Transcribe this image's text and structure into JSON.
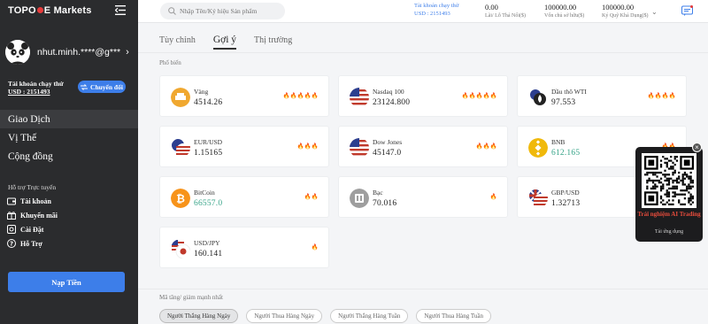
{
  "sidebar": {
    "logo_left": "TOPO",
    "logo_right": "E Markets",
    "username": "nhut.minh.****@g***",
    "account_label": "Tài khoản chạy thử",
    "account_id": "USD : 2151493",
    "switch_label": "Chuyển đổi",
    "nav": [
      {
        "label": "Giao Dịch"
      },
      {
        "label": "Vị Thế"
      },
      {
        "label": "Cộng đồng"
      }
    ],
    "support_label": "Hỗ trợ Trực tuyến",
    "sub_nav": [
      {
        "label": "Tài khoản",
        "icon": "wallet-icon"
      },
      {
        "label": "Khuyến mãi",
        "icon": "gift-icon"
      },
      {
        "label": "Cài Đặt",
        "icon": "settings-icon"
      },
      {
        "label": "Hỗ Trợ",
        "icon": "help-icon"
      }
    ],
    "deposit_label": "Nạp Tiền"
  },
  "header": {
    "search_placeholder": "Nhập Tên/Ký hiệu Sản phẩm",
    "acct_title": "Tài khoản chạy thử",
    "acct_id": "USD : 2151493",
    "stats": [
      {
        "value": "0.00",
        "label": "Lãi/ Lỗ Thả Nổi($)"
      },
      {
        "value": "100000.00",
        "label": "Vốn chủ sở hữu($)"
      },
      {
        "value": "100000.00",
        "label": "Ký Quỹ Khả Dụng($)"
      }
    ]
  },
  "tabs": [
    {
      "label": "Tùy chỉnh"
    },
    {
      "label": "Gợi ý"
    },
    {
      "label": "Thị trường"
    }
  ],
  "section_label": "Phổ biến",
  "cards": [
    {
      "name": "Vàng",
      "price": "4514.26",
      "fire": "🔥🔥🔥🔥🔥",
      "icon": "gold-bar-icon",
      "green": false
    },
    {
      "name": "Nasdaq 100",
      "price": "23124.800",
      "fire": "🔥🔥🔥🔥🔥",
      "icon": "us-flag-icon",
      "green": false
    },
    {
      "name": "Dầu thô WTI",
      "price": "97.553",
      "fire": "🔥🔥🔥🔥",
      "icon": "oil-drop-icon",
      "green": false
    },
    {
      "name": "EUR/USD",
      "price": "1.15165",
      "fire": "🔥🔥🔥",
      "icon": "eur-usd-flag-icon",
      "green": false
    },
    {
      "name": "Dow Jones",
      "price": "45147.0",
      "fire": "🔥🔥🔥",
      "icon": "us-flag-icon",
      "green": false
    },
    {
      "name": "BNB",
      "price": "612.165",
      "fire": "🔥🔥",
      "icon": "bnb-icon",
      "green": true
    },
    {
      "name": "BitCoin",
      "price": "66557.0",
      "fire": "🔥🔥",
      "icon": "bitcoin-icon",
      "green": true
    },
    {
      "name": "Bạc",
      "price": "70.016",
      "fire": "🔥",
      "icon": "silver-bar-icon",
      "green": false
    },
    {
      "name": "GBP/USD",
      "price": "1.32713",
      "fire": "🔥",
      "icon": "gbp-usd-flag-icon",
      "green": false
    },
    {
      "name": "USD/JPY",
      "price": "160.141",
      "fire": "🔥",
      "icon": "usd-jpy-flag-icon",
      "green": false
    }
  ],
  "bottom_label": "Mã tăng/ giảm mạnh nhất",
  "filters": [
    {
      "label": "Người Thắng Hàng Ngày"
    },
    {
      "label": "Người Thua Hàng Ngày"
    },
    {
      "label": "Người Thắng Hàng Tuần"
    },
    {
      "label": "Người Thua Hàng Tuần"
    }
  ],
  "qr": {
    "title": "Trải nghiệm AI Trading",
    "subtitle": "Tải ứng dụng"
  },
  "colors": {
    "accent": "#3d7ee9",
    "sidebar_bg": "#2b2c2e",
    "fire": "#e53b3b",
    "up_green": "#3aa58a"
  }
}
